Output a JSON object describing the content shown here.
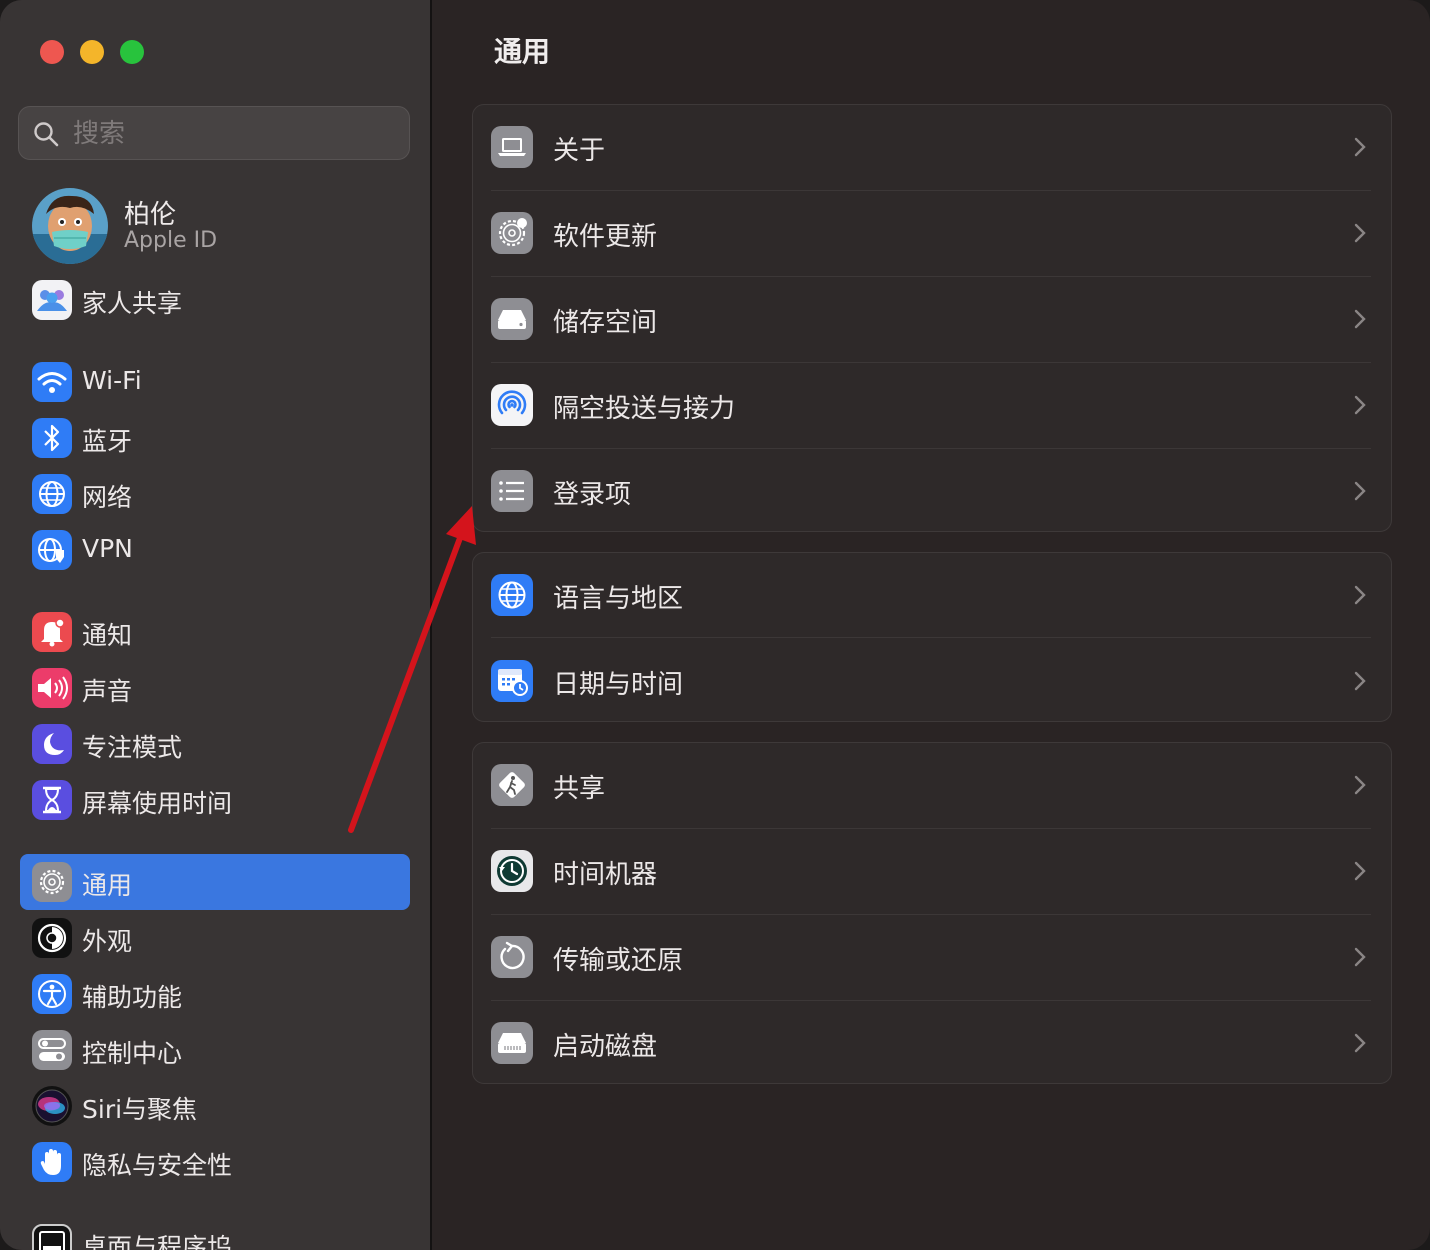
{
  "window": {
    "traffic_lights": {
      "close": "#ee5750",
      "minimize": "#f4b52a",
      "zoom": "#28c33d"
    }
  },
  "sidebar": {
    "search_placeholder": "搜索",
    "account": {
      "name": "柏伦",
      "subtitle": "Apple ID"
    },
    "items": [
      {
        "label": "家人共享",
        "icon": "family-icon"
      },
      {
        "label": "Wi-Fi",
        "icon": "wifi-icon"
      },
      {
        "label": "蓝牙",
        "icon": "bluetooth-icon"
      },
      {
        "label": "网络",
        "icon": "globe-icon"
      },
      {
        "label": "VPN",
        "icon": "vpn-icon"
      },
      {
        "label": "通知",
        "icon": "bell-icon"
      },
      {
        "label": "声音",
        "icon": "speaker-icon"
      },
      {
        "label": "专注模式",
        "icon": "moon-icon"
      },
      {
        "label": "屏幕使用时间",
        "icon": "hourglass-icon"
      },
      {
        "label": "通用",
        "icon": "gear-icon",
        "selected": true
      },
      {
        "label": "外观",
        "icon": "appearance-icon"
      },
      {
        "label": "辅助功能",
        "icon": "accessibility-icon"
      },
      {
        "label": "控制中心",
        "icon": "toggles-icon"
      },
      {
        "label": "Siri与聚焦",
        "icon": "siri-icon"
      },
      {
        "label": "隐私与安全性",
        "icon": "hand-icon"
      },
      {
        "label": "桌面与程序坞",
        "icon": "dock-icon"
      }
    ],
    "accent_color": "#3a77e0"
  },
  "main": {
    "title": "通用",
    "groups": [
      {
        "rows": [
          {
            "label": "关于",
            "icon": "laptop-icon"
          },
          {
            "label": "软件更新",
            "icon": "software-update-gear-icon"
          },
          {
            "label": "储存空间",
            "icon": "drive-icon"
          },
          {
            "label": "隔空投送与接力",
            "icon": "airdrop-icon"
          },
          {
            "label": "登录项",
            "icon": "list-icon"
          }
        ]
      },
      {
        "rows": [
          {
            "label": "语言与地区",
            "icon": "globe-icon"
          },
          {
            "label": "日期与时间",
            "icon": "calendar-clock-icon"
          }
        ]
      },
      {
        "rows": [
          {
            "label": "共享",
            "icon": "sharing-icon"
          },
          {
            "label": "时间机器",
            "icon": "time-machine-icon"
          },
          {
            "label": "传输或还原",
            "icon": "restore-icon"
          },
          {
            "label": "启动磁盘",
            "icon": "startup-disk-icon"
          }
        ]
      }
    ],
    "annotation_arrow_color": "#d4141c"
  }
}
